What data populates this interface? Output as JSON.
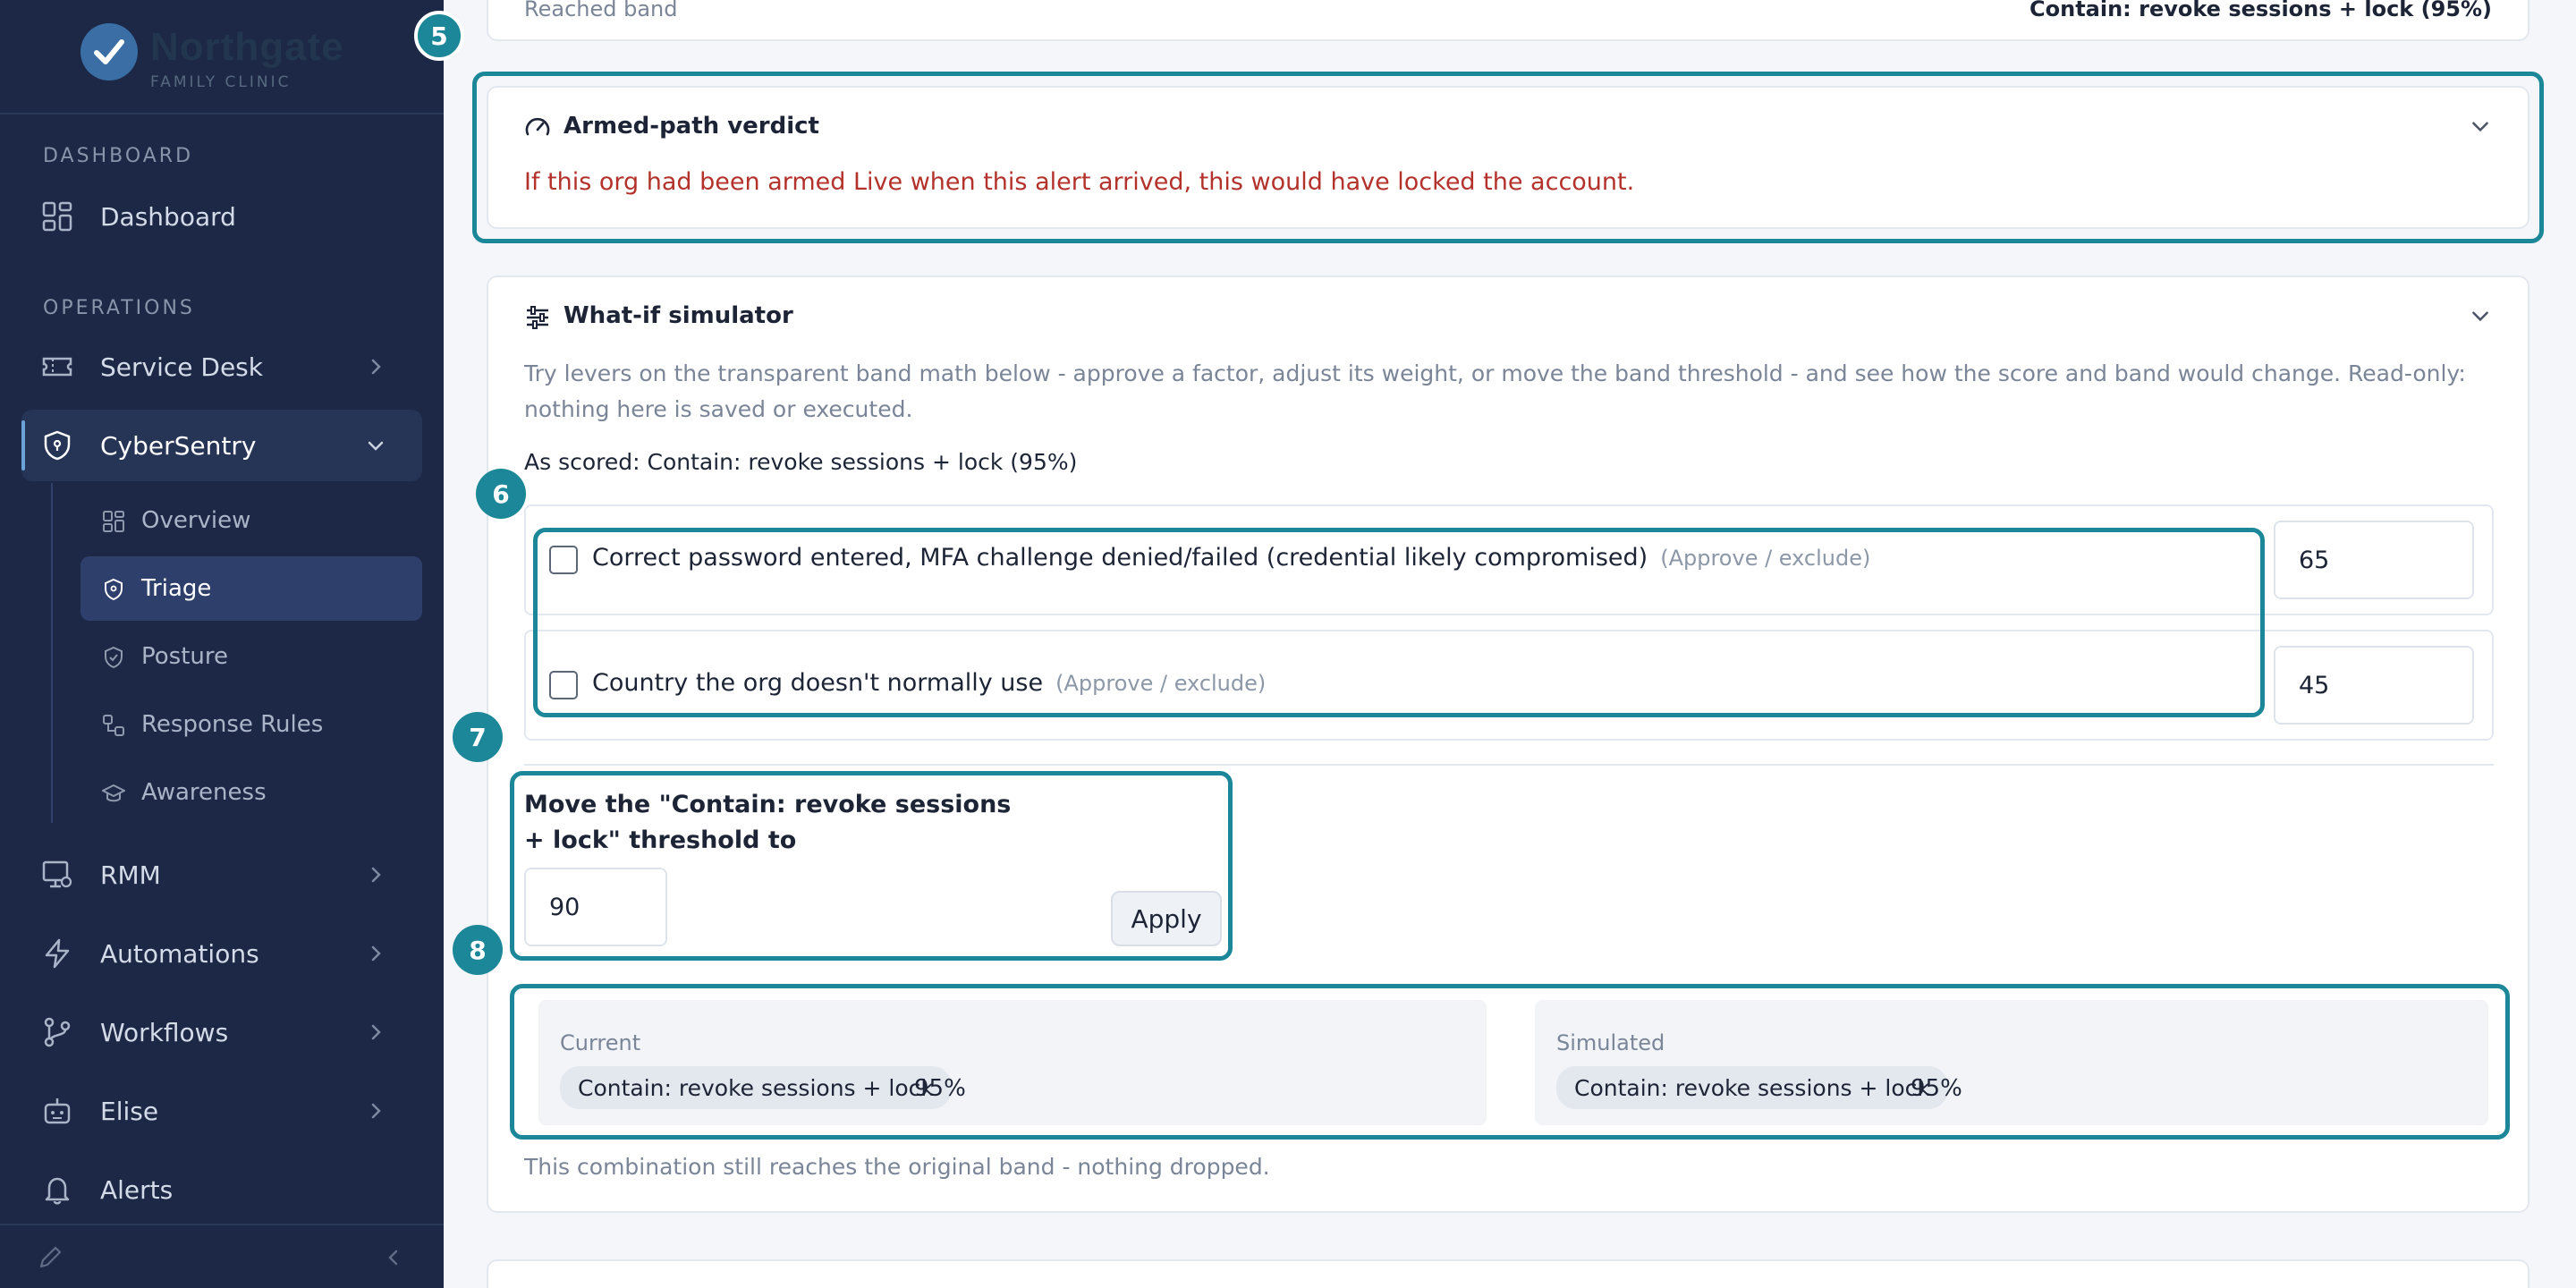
{
  "brand": {
    "name": "Northgate",
    "subtitle": "FAMILY CLINIC"
  },
  "sidebar": {
    "sections": {
      "dashboard": "DASHBOARD",
      "operations": "OPERATIONS"
    },
    "items": [
      {
        "label": "Dashboard",
        "icon": "dashboard-grid-icon"
      },
      {
        "label": "Service Desk",
        "icon": "ticket-icon"
      },
      {
        "label": "CyberSentry",
        "icon": "shield-icon",
        "active": true
      },
      {
        "label": "RMM",
        "icon": "monitor-gear-icon"
      },
      {
        "label": "Automations",
        "icon": "lightning-icon"
      },
      {
        "label": "Workflows",
        "icon": "branch-icon"
      },
      {
        "label": "Elise",
        "icon": "robot-icon"
      },
      {
        "label": "Alerts",
        "icon": "bell-icon"
      }
    ],
    "subitems": [
      {
        "label": "Overview",
        "icon": "grid-icon"
      },
      {
        "label": "Triage",
        "icon": "shield-small-icon",
        "active": true
      },
      {
        "label": "Posture",
        "icon": "shield-check-icon"
      },
      {
        "label": "Response Rules",
        "icon": "rules-icon"
      },
      {
        "label": "Awareness",
        "icon": "graduation-cap-icon"
      }
    ]
  },
  "top_card": {
    "left_text": "Reached band",
    "right_text": "Contain: revoke sessions + lock (95%)"
  },
  "markers": [
    "5",
    "6",
    "7",
    "8"
  ],
  "verdict": {
    "title": "Armed-path verdict",
    "message": "If this org had been armed Live when this alert arrived, this would have locked the account."
  },
  "simulator": {
    "title": "What-if simulator",
    "description": "Try levers on the transparent band math below - approve a factor, adjust its weight, or move the band threshold - and see how the score and band would change. Read-only: nothing here is saved or executed.",
    "as_scored": "As scored: Contain: revoke sessions + lock (95%)",
    "factors": [
      {
        "label": "Correct password entered, MFA challenge denied/failed (credential likely compromised)",
        "hint": "(Approve / exclude)",
        "weight": "65",
        "checked": false
      },
      {
        "label": "Country the org doesn't normally use",
        "hint": "(Approve / exclude)",
        "weight": "45",
        "checked": false
      }
    ],
    "threshold": {
      "label": "Move the \"Contain: revoke sessions + lock\" threshold to",
      "value": "90",
      "apply_label": "Apply"
    },
    "comparison": {
      "current": {
        "label": "Current",
        "band": "Contain: revoke sessions + lock",
        "score": "95%"
      },
      "simulated": {
        "label": "Simulated",
        "band": "Contain: revoke sessions + lock",
        "score": "95%"
      }
    },
    "result_note": "This combination still reaches the original band - nothing dropped."
  },
  "colors": {
    "sidebar_bg": "#1c2846",
    "accent_teal": "#1b8798",
    "verdict_red": "#b3322b"
  }
}
